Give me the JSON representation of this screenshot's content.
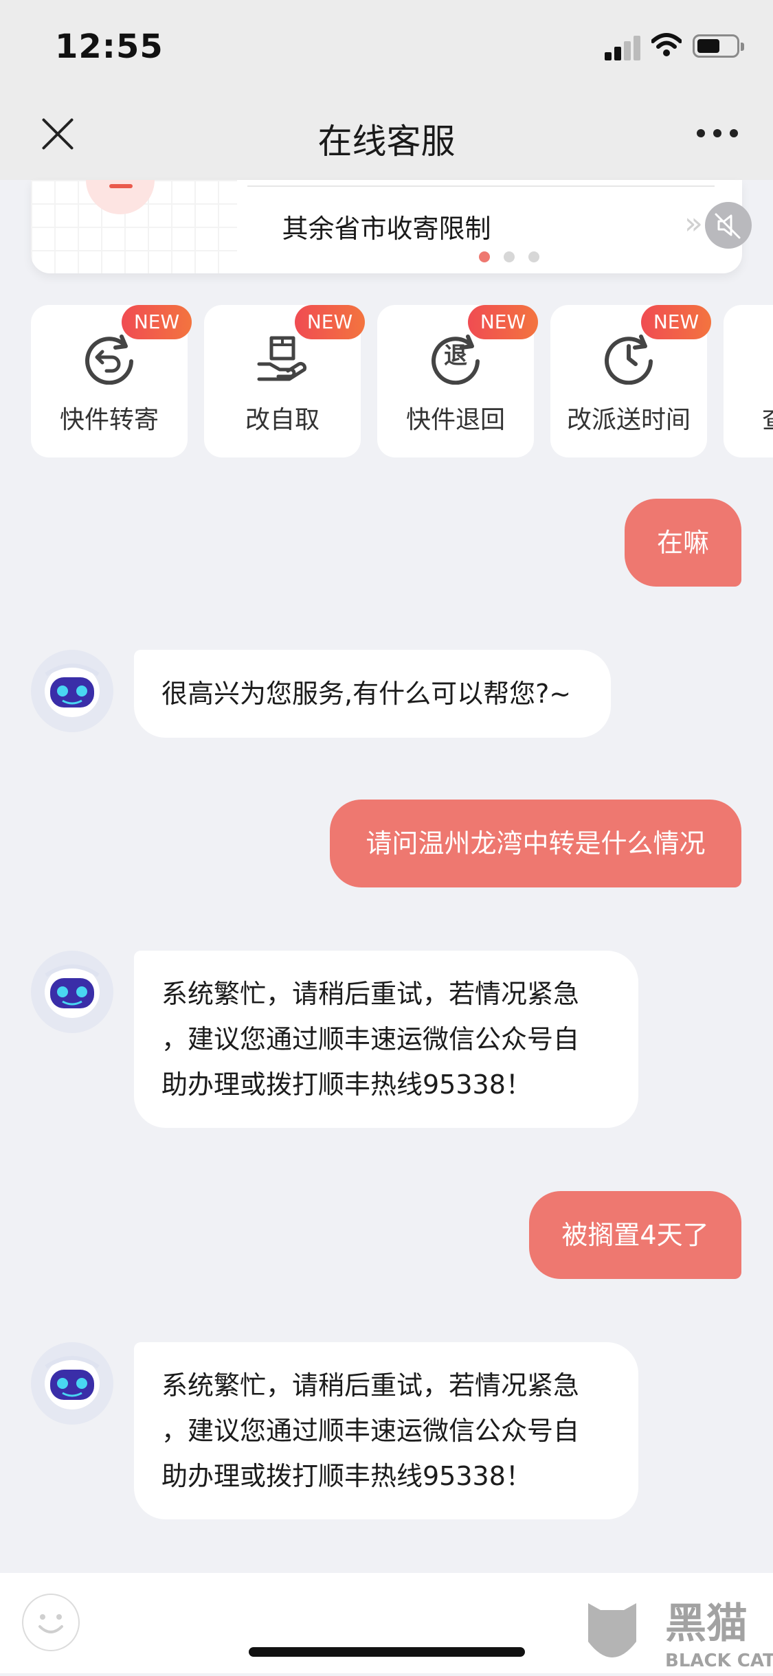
{
  "status_bar": {
    "time": "12:55"
  },
  "nav": {
    "title": "在线客服",
    "close_icon": "close-icon",
    "more_icon": "more-icon"
  },
  "banner": {
    "text": "其余省市收寄限制",
    "slide_count": 3,
    "active_slide": 1,
    "mute_icon": "speaker-muted-icon"
  },
  "quick_actions": [
    {
      "label": "快件转寄",
      "badge": "NEW",
      "icon": "redirect-icon"
    },
    {
      "label": "改自取",
      "badge": "NEW",
      "icon": "self-pickup-icon"
    },
    {
      "label": "快件退回",
      "badge": "NEW",
      "icon": "return-icon",
      "icon_glyph": "退"
    },
    {
      "label": "改派送时间",
      "badge": "NEW",
      "icon": "clock-icon"
    },
    {
      "label": "查",
      "badge": "",
      "icon": "query-icon"
    }
  ],
  "messages": [
    {
      "from": "user",
      "text": "在嘛"
    },
    {
      "from": "bot",
      "lines": [
        "很高兴为您服务,有什么可以帮您?~"
      ]
    },
    {
      "from": "user",
      "text": "请问温州龙湾中转是什么情况"
    },
    {
      "from": "bot",
      "lines": [
        "系统繁忙，请稍后重试，若情况紧急",
        "，建议您通过顺丰速运微信公众号自",
        "助办理或拨打顺丰热线95338！"
      ]
    },
    {
      "from": "user",
      "text": "被搁置4天了"
    },
    {
      "from": "bot",
      "lines": [
        "系统繁忙，请稍后重试，若情况紧急",
        "，建议您通过顺丰速运微信公众号自",
        "助办理或拨打顺丰热线95338！"
      ]
    }
  ],
  "input_bar": {
    "emoji_icon": "emoji-icon"
  },
  "watermark": {
    "text_cn": "黑猫",
    "text_en": "BLACK CAT"
  },
  "colors": {
    "user_bubble": "#ee7870",
    "badge_start": "#f04c52",
    "badge_end": "#f3743f",
    "page_bg": "#f0f1f5"
  }
}
